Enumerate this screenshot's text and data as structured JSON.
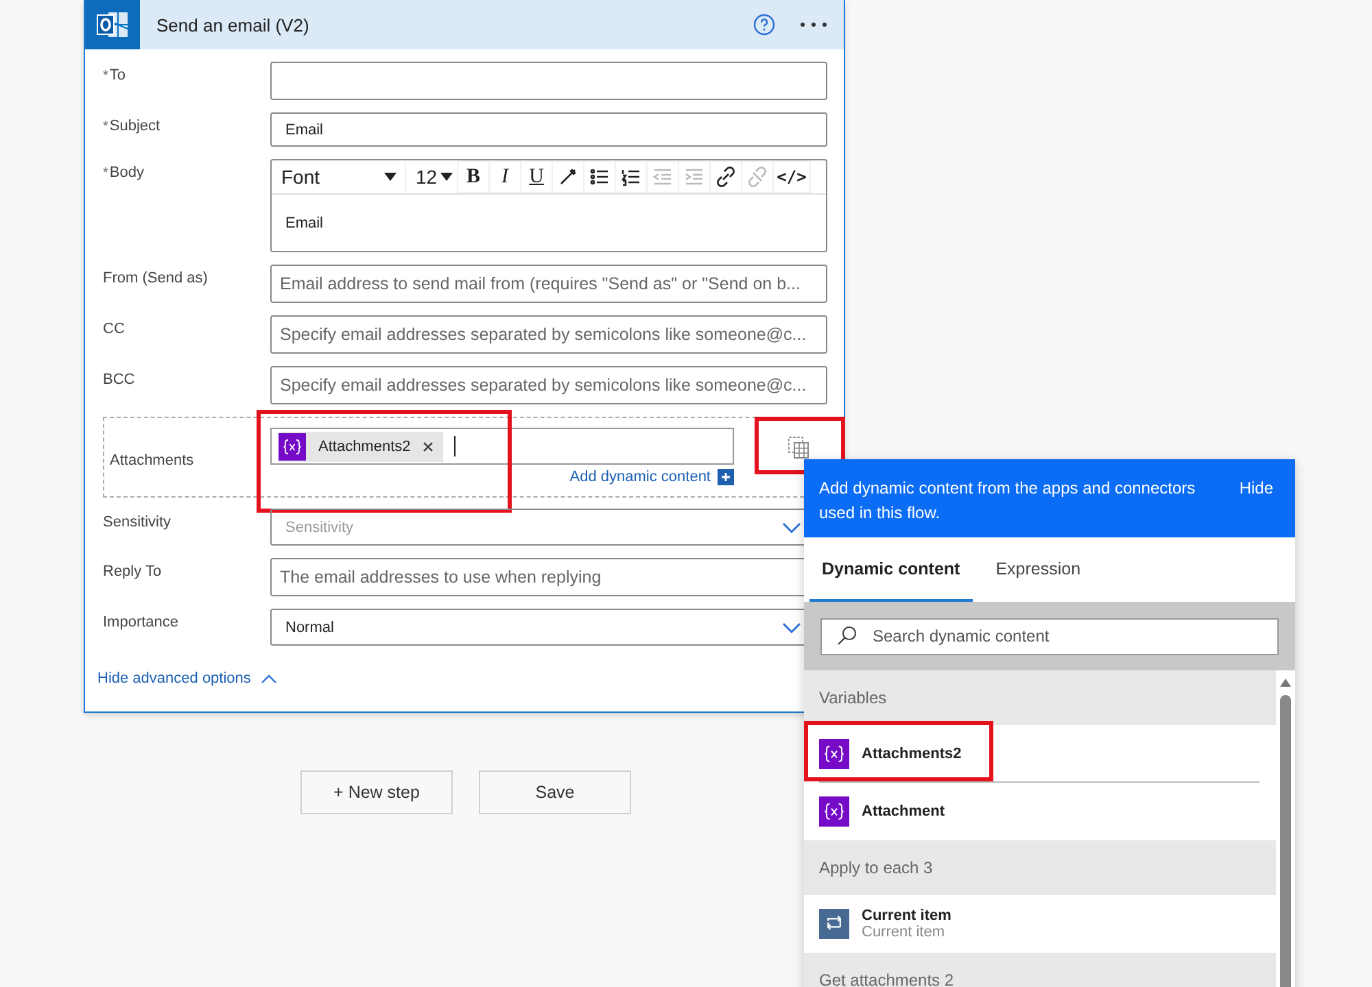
{
  "card": {
    "title": "Send an email (V2)"
  },
  "required_mark": "*",
  "fields": [
    {
      "kind": "text",
      "label": "To",
      "required": true
    },
    {
      "kind": "text",
      "label": "Subject",
      "required": true,
      "value": "Email"
    },
    {
      "kind": "richtext",
      "label": "Body",
      "required": true,
      "value": "Email"
    },
    {
      "kind": "text",
      "label": "From (Send as)",
      "required": false,
      "placeholder": "Email address to send mail from (requires \"Send as\" or \"Send on b..."
    },
    {
      "kind": "text",
      "label": "CC",
      "required": false,
      "placeholder": "Specify email addresses separated by semicolons like someone@c..."
    },
    {
      "kind": "text",
      "label": "BCC",
      "required": false,
      "placeholder": "Specify email addresses separated by semicolons like someone@c..."
    },
    {
      "kind": "attachments",
      "label": "Attachments",
      "required": false,
      "tokens": [
        {
          "label": "Attachments2",
          "highlighted": true
        }
      ],
      "dynamic_link": "Add dynamic content"
    },
    {
      "kind": "dropdown",
      "label": "Sensitivity",
      "required": false,
      "placeholder": "Sensitivity"
    },
    {
      "kind": "text",
      "label": "Reply To",
      "required": false,
      "placeholder": "The email addresses to use when replying"
    },
    {
      "kind": "dropdown",
      "label": "Importance",
      "required": false,
      "value": "Normal"
    }
  ],
  "toolbar": {
    "font": "Font",
    "size": "12",
    "buttons": [
      {
        "kind": "bold",
        "label": "B",
        "disabled": false
      },
      {
        "kind": "italic",
        "label": "I",
        "disabled": false
      },
      {
        "kind": "underline",
        "label": "U",
        "disabled": false
      },
      {
        "kind": "pen",
        "disabled": false
      },
      {
        "kind": "bullets",
        "disabled": false
      },
      {
        "kind": "numbers",
        "disabled": false
      },
      {
        "kind": "outdent",
        "disabled": true
      },
      {
        "kind": "indent",
        "disabled": true
      },
      {
        "kind": "link",
        "disabled": false
      },
      {
        "kind": "unlink",
        "disabled": true
      },
      {
        "kind": "code",
        "label": "</>",
        "disabled": false
      }
    ]
  },
  "dynamic_button": {
    "highlighted": true
  },
  "advanced_link": "Hide advanced options",
  "buttons": [
    {
      "label": "+ New step"
    },
    {
      "label": "Save"
    }
  ],
  "panel": {
    "intro": "Add dynamic content from the apps and connectors used in this flow.",
    "hide": "Hide",
    "tabs": [
      {
        "label": "Dynamic content",
        "selected": true
      },
      {
        "label": "Expression",
        "selected": false
      }
    ],
    "search": {
      "placeholder": "Search dynamic content"
    },
    "groups": [
      {
        "title": "Variables",
        "items": [
          {
            "kind": "variable",
            "label": "Attachments2",
            "highlighted": true
          },
          {
            "kind": "variable",
            "label": "Attachment",
            "highlighted": false
          }
        ]
      },
      {
        "title": "Apply to each 3",
        "items": [
          {
            "kind": "loop",
            "label": "Current item",
            "subtitle": "Current item",
            "highlighted": false
          }
        ]
      },
      {
        "title": "Get attachments 2"
      }
    ]
  }
}
